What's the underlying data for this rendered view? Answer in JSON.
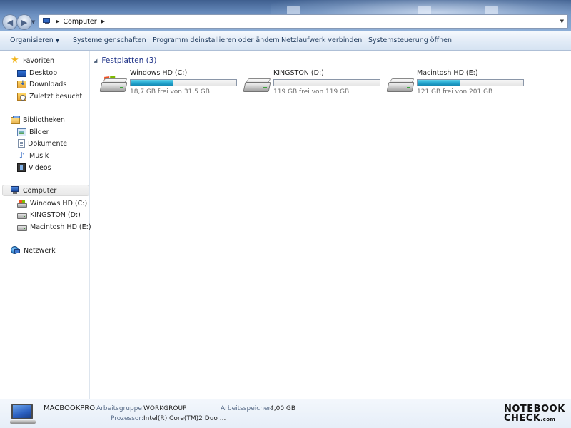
{
  "address": {
    "location": "Computer"
  },
  "toolbar": {
    "organize": "Organisieren",
    "system_properties": "Systemeigenschaften",
    "uninstall": "Programm deinstallieren oder ändern",
    "map_drive": "Netzlaufwerk verbinden",
    "control_panel": "Systemsteuerung öffnen"
  },
  "sidebar": {
    "favorites": {
      "label": "Favoriten",
      "items": [
        {
          "label": "Desktop",
          "icon": "desktop-icon"
        },
        {
          "label": "Downloads",
          "icon": "downloads-folder-icon"
        },
        {
          "label": "Zuletzt besucht",
          "icon": "recent-places-icon"
        }
      ]
    },
    "libraries": {
      "label": "Bibliotheken",
      "items": [
        {
          "label": "Bilder",
          "icon": "pictures-icon"
        },
        {
          "label": "Dokumente",
          "icon": "documents-icon"
        },
        {
          "label": "Musik",
          "icon": "music-icon"
        },
        {
          "label": "Videos",
          "icon": "videos-icon"
        }
      ]
    },
    "computer": {
      "label": "Computer",
      "selected": true,
      "items": [
        {
          "label": "Windows HD (C:)",
          "icon": "windows-drive-icon"
        },
        {
          "label": "KINGSTON (D:)",
          "icon": "hard-drive-icon"
        },
        {
          "label": "Macintosh HD (E:)",
          "icon": "hard-drive-icon"
        }
      ]
    },
    "network": {
      "label": "Netzwerk"
    }
  },
  "content": {
    "group_title": "Festplatten (3)",
    "drives": [
      {
        "name": "Windows HD (C:)",
        "free_text": "18,7 GB frei von 31,5 GB",
        "used_fraction": 0.406,
        "icon": "windows-drive-icon"
      },
      {
        "name": "KINGSTON (D:)",
        "free_text": "119 GB frei von 119 GB",
        "used_fraction": 0.0,
        "icon": "hard-drive-icon"
      },
      {
        "name": "Macintosh HD (E:)",
        "free_text": "121 GB frei von 201 GB",
        "used_fraction": 0.398,
        "icon": "hard-drive-icon"
      }
    ],
    "bar_color": "#26a9d1"
  },
  "details": {
    "computer_name": "MACBOOKPRO",
    "workgroup_label": "Arbeitsgruppe:",
    "workgroup_value": "WORKGROUP",
    "memory_label": "Arbeitsspeicher:",
    "memory_value": "4,00 GB",
    "processor_label": "Prozessor:",
    "processor_value": "Intel(R) Core(TM)2 Duo ..."
  },
  "watermark": {
    "line1": "NOTEBOOK",
    "line2": "CHECK",
    "suffix": ".com"
  }
}
